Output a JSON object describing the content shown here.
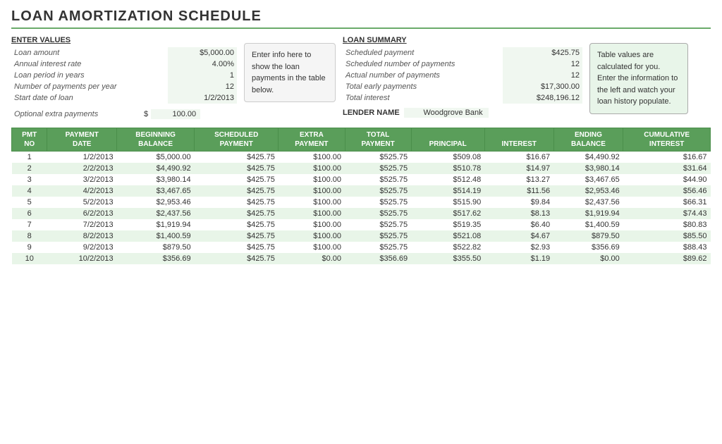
{
  "title": "LOAN AMORTIZATION SCHEDULE",
  "enter_values": {
    "heading": "ENTER VALUES",
    "fields": [
      {
        "label": "Loan amount",
        "value": "$5,000.00"
      },
      {
        "label": "Annual interest rate",
        "value": "4.00%"
      },
      {
        "label": "Loan period in years",
        "value": "1"
      },
      {
        "label": "Number of payments per year",
        "value": "12"
      },
      {
        "label": "Start date of loan",
        "value": "1/2/2013"
      }
    ],
    "extra_label": "Optional extra payments",
    "extra_dollar": "$",
    "extra_value": "100.00"
  },
  "info_bubble": "Enter info here to show the loan payments in the table below.",
  "loan_summary": {
    "heading": "LOAN SUMMARY",
    "fields": [
      {
        "label": "Scheduled payment",
        "value": "$425.75"
      },
      {
        "label": "Scheduled number of payments",
        "value": "12"
      },
      {
        "label": "Actual number of payments",
        "value": "12"
      },
      {
        "label": "Total early payments",
        "value": "$17,300.00"
      },
      {
        "label": "Total interest",
        "value": "$248,196.12"
      }
    ],
    "lender_label": "LENDER NAME",
    "lender_value": "Woodgrove Bank"
  },
  "tip_bubble": "Table values are calculated for you. Enter the information to the left and watch your loan history populate.",
  "table": {
    "headers": [
      [
        "PMT",
        "NO"
      ],
      [
        "PAYMENT",
        "DATE"
      ],
      [
        "BEGINNING",
        "BALANCE"
      ],
      [
        "SCHEDULED",
        "PAYMENT"
      ],
      [
        "EXTRA",
        "PAYMENT"
      ],
      [
        "TOTAL",
        "PAYMENT"
      ],
      [
        "PRINCIPAL",
        ""
      ],
      [
        "INTEREST",
        ""
      ],
      [
        "ENDING",
        "BALANCE"
      ],
      [
        "CUMULATIVE",
        "INTEREST"
      ]
    ],
    "rows": [
      [
        "1",
        "1/2/2013",
        "$5,000.00",
        "$425.75",
        "$100.00",
        "$525.75",
        "$509.08",
        "$16.67",
        "$4,490.92",
        "$16.67"
      ],
      [
        "2",
        "2/2/2013",
        "$4,490.92",
        "$425.75",
        "$100.00",
        "$525.75",
        "$510.78",
        "$14.97",
        "$3,980.14",
        "$31.64"
      ],
      [
        "3",
        "3/2/2013",
        "$3,980.14",
        "$425.75",
        "$100.00",
        "$525.75",
        "$512.48",
        "$13.27",
        "$3,467.65",
        "$44.90"
      ],
      [
        "4",
        "4/2/2013",
        "$3,467.65",
        "$425.75",
        "$100.00",
        "$525.75",
        "$514.19",
        "$11.56",
        "$2,953.46",
        "$56.46"
      ],
      [
        "5",
        "5/2/2013",
        "$2,953.46",
        "$425.75",
        "$100.00",
        "$525.75",
        "$515.90",
        "$9.84",
        "$2,437.56",
        "$66.31"
      ],
      [
        "6",
        "6/2/2013",
        "$2,437.56",
        "$425.75",
        "$100.00",
        "$525.75",
        "$517.62",
        "$8.13",
        "$1,919.94",
        "$74.43"
      ],
      [
        "7",
        "7/2/2013",
        "$1,919.94",
        "$425.75",
        "$100.00",
        "$525.75",
        "$519.35",
        "$6.40",
        "$1,400.59",
        "$80.83"
      ],
      [
        "8",
        "8/2/2013",
        "$1,400.59",
        "$425.75",
        "$100.00",
        "$525.75",
        "$521.08",
        "$4.67",
        "$879.50",
        "$85.50"
      ],
      [
        "9",
        "9/2/2013",
        "$879.50",
        "$425.75",
        "$100.00",
        "$525.75",
        "$522.82",
        "$2.93",
        "$356.69",
        "$88.43"
      ],
      [
        "10",
        "10/2/2013",
        "$356.69",
        "$425.75",
        "$0.00",
        "$356.69",
        "$355.50",
        "$1.19",
        "$0.00",
        "$89.62"
      ]
    ]
  }
}
